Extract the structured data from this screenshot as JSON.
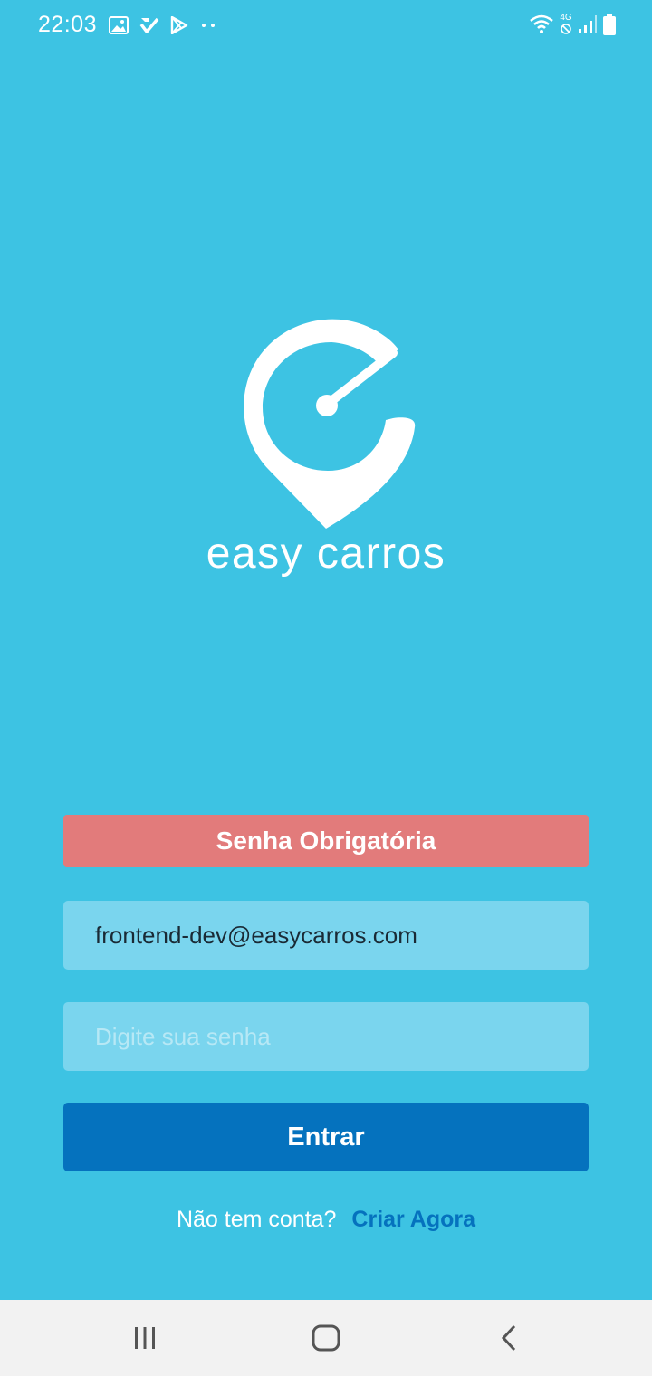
{
  "status_bar": {
    "time": "22:03",
    "left_icons": [
      "gallery-icon",
      "check-app-icon",
      "play-store-icon",
      "more-dots-icon"
    ],
    "right_icons": [
      "wifi-icon",
      "mobile-data-icon",
      "signal-icon",
      "battery-icon"
    ],
    "network_label": "4G"
  },
  "brand": {
    "name": "easy carros",
    "logo_icon": "speedometer-pin-logo"
  },
  "form": {
    "error_message": "Senha Obrigatória",
    "email_value": "frontend-dev@easycarros.com",
    "password_placeholder": "Digite sua senha",
    "login_label": "Entrar",
    "signup_prompt": "Não tem conta?",
    "signup_link": "Criar Agora"
  },
  "nav_bar": {
    "icons": [
      "recent-apps-icon",
      "home-icon",
      "back-icon"
    ]
  },
  "colors": {
    "background": "#3dc3e3",
    "error": "#e27b7b",
    "field": "#7ad5ee",
    "primary": "#0572be",
    "nav_background": "#f2f2f2"
  }
}
